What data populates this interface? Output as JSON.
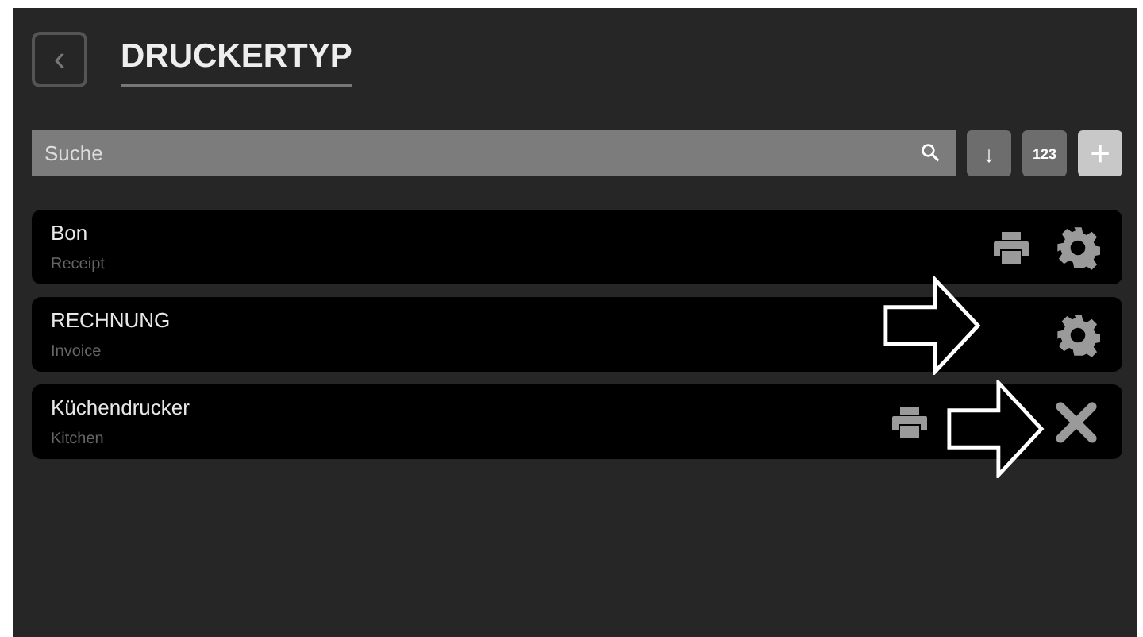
{
  "header": {
    "back_icon": "‹",
    "title": "DRUCKERTYP"
  },
  "search": {
    "placeholder": "Suche",
    "sort_icon": "↓",
    "number_button": "123",
    "add_icon": "+"
  },
  "rows": [
    {
      "name": "Bon",
      "subtitle": "Receipt",
      "actions": [
        {
          "kind": "printer"
        },
        {
          "kind": "settings"
        }
      ],
      "arrow": false
    },
    {
      "name": "RECHNUNG",
      "subtitle": "Invoice",
      "actions": [
        {
          "kind": "settings"
        }
      ],
      "arrow": true
    },
    {
      "name": "Küchendrucker",
      "subtitle": "Kitchen",
      "actions": [
        {
          "kind": "printer"
        },
        {
          "kind": "delete"
        }
      ],
      "arrow": true
    }
  ]
}
